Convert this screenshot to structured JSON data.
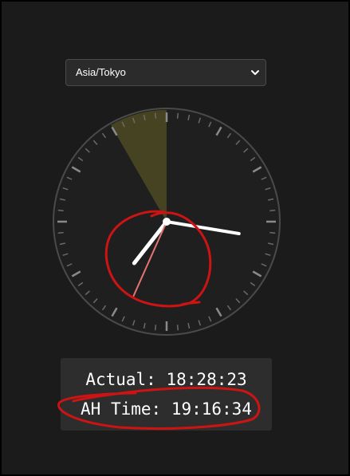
{
  "timezone_select": {
    "selected": "Asia/Tokyo",
    "icon": "chevron-down-icon"
  },
  "clock": {
    "hour": 19,
    "minute": 16,
    "second": 34,
    "highlight_wedge_color": "#4d4a24",
    "hand_color": "#ffffff",
    "second_hand_color": "#e57373"
  },
  "readout": {
    "actual_label": "Actual:",
    "actual_time": "18:28:23",
    "ah_label": "AH Time:",
    "ah_time": "19:16:34"
  },
  "annotation_color": "#cc1414"
}
